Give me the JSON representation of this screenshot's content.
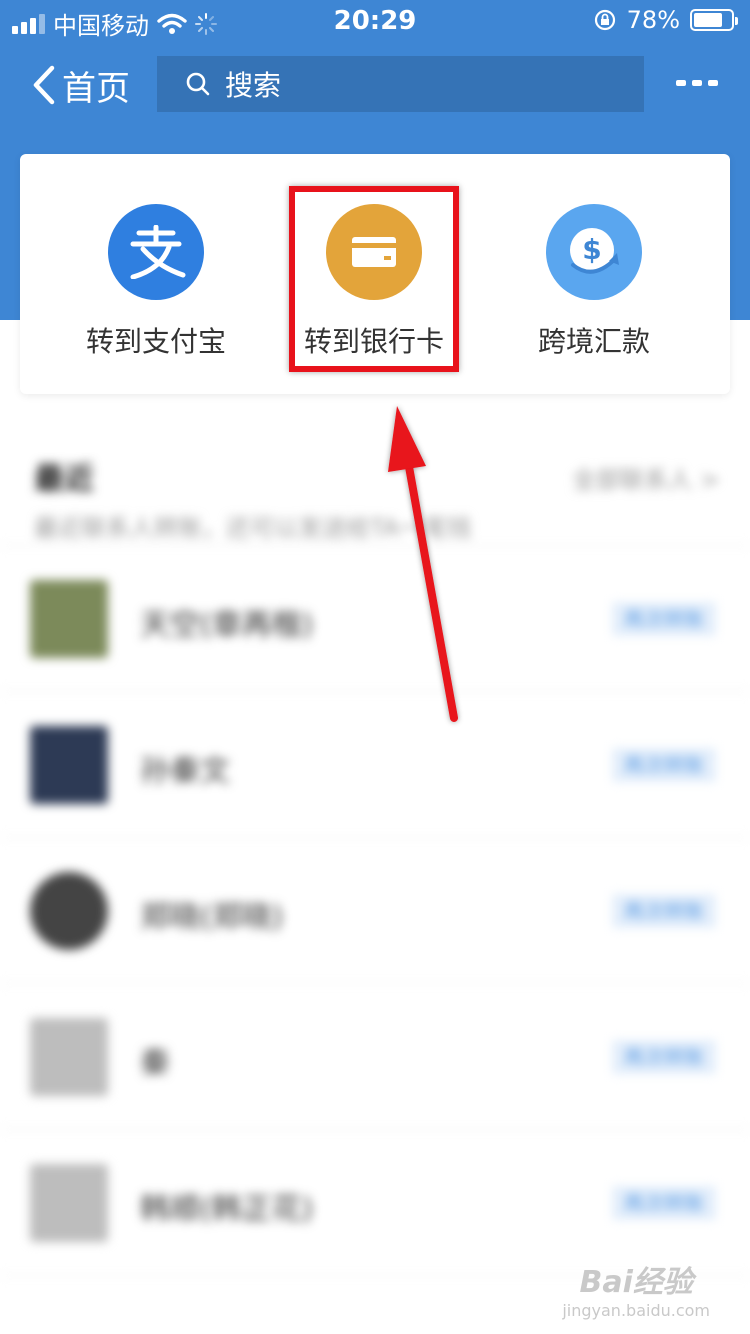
{
  "status_bar": {
    "carrier": "中国移动",
    "time": "20:29",
    "battery_text": "78%",
    "battery_level": 0.78
  },
  "nav": {
    "back_label": "首页",
    "search_placeholder": "搜索"
  },
  "actions": [
    {
      "label": "转到支付宝",
      "icon": "alipay-icon",
      "color": "#2f7fe0"
    },
    {
      "label": "转到银行卡",
      "icon": "bank-card-icon",
      "color": "#e3a43a"
    },
    {
      "label": "跨境汇款",
      "icon": "dollar-exchange-icon",
      "color": "#5aa6ef"
    }
  ],
  "recent": {
    "title": "最近",
    "subtitle": "最近联系人转账，还可以发送给TA一笔钱",
    "more": "全部联系人 >",
    "rows": [
      {
        "name": "天空(章再楷)",
        "button": "再次转账"
      },
      {
        "name": "孙秦文",
        "button": "再次转账"
      },
      {
        "name": "郑晓(郑晓)",
        "button": "再次转账"
      },
      {
        "name": "秦",
        "button": "再次转账"
      },
      {
        "name": "韩顺(韩正花)",
        "button": "再次转账"
      }
    ]
  },
  "watermark": {
    "line1": "Bai经验",
    "line2": "jingyan.baidu.com"
  },
  "colors": {
    "header": "#3e86d4",
    "highlight": "#e8121b"
  }
}
